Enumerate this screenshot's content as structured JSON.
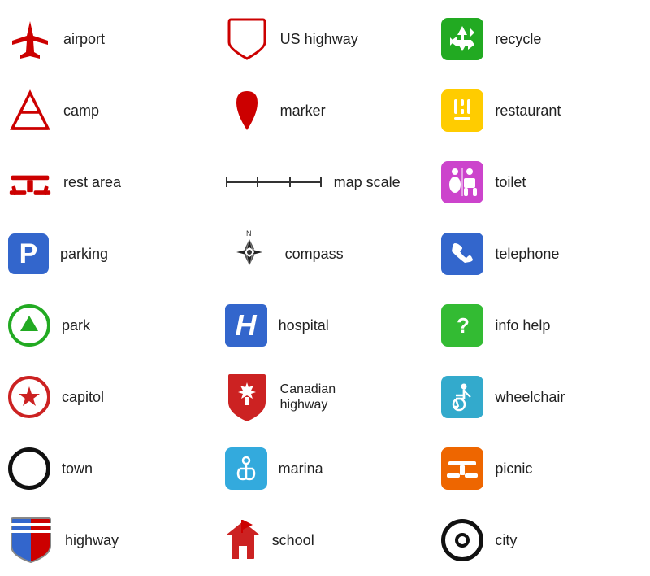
{
  "items": [
    {
      "id": "airport",
      "label": "airport"
    },
    {
      "id": "us-highway",
      "label": "US highway"
    },
    {
      "id": "recycle",
      "label": "recycle"
    },
    {
      "id": "camp",
      "label": "camp"
    },
    {
      "id": "marker",
      "label": "marker"
    },
    {
      "id": "restaurant",
      "label": "restaurant"
    },
    {
      "id": "rest-area",
      "label": "rest area"
    },
    {
      "id": "map-scale",
      "label": "map scale"
    },
    {
      "id": "toilet",
      "label": "toilet"
    },
    {
      "id": "parking",
      "label": "parking"
    },
    {
      "id": "compass",
      "label": "compass"
    },
    {
      "id": "telephone",
      "label": "telephone"
    },
    {
      "id": "park",
      "label": "park"
    },
    {
      "id": "hospital",
      "label": "hospital"
    },
    {
      "id": "info-help",
      "label": "info help"
    },
    {
      "id": "capitol",
      "label": "capitol"
    },
    {
      "id": "canadian-highway",
      "label": "Canadian highway"
    },
    {
      "id": "wheelchair",
      "label": "wheelchair"
    },
    {
      "id": "town",
      "label": "town"
    },
    {
      "id": "marina",
      "label": "marina"
    },
    {
      "id": "picnic",
      "label": "picnic"
    },
    {
      "id": "highway",
      "label": "highway"
    },
    {
      "id": "school",
      "label": "school"
    },
    {
      "id": "city",
      "label": "city"
    }
  ]
}
